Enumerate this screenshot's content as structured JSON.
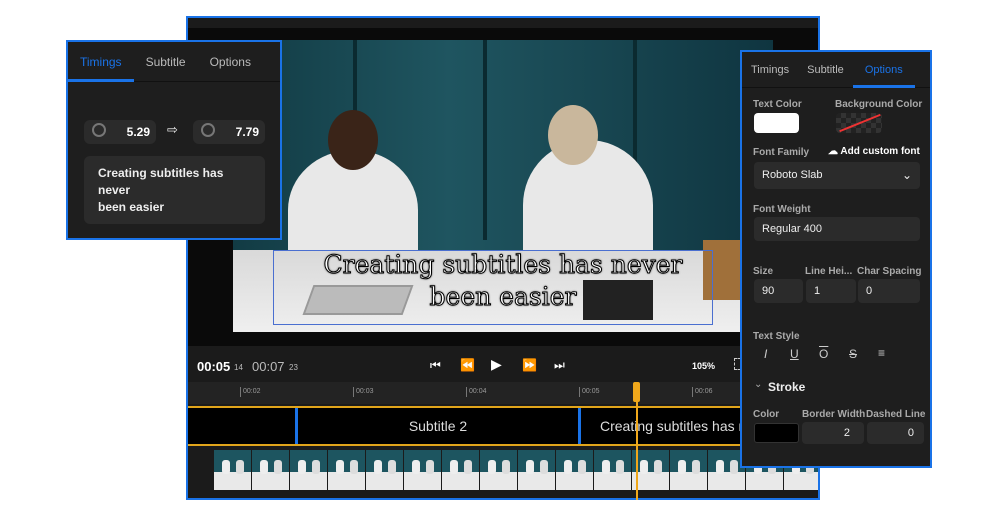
{
  "colors": {
    "accent": "#1a73e8",
    "playhead": "#f0a81b",
    "track_border": "#e1a51b"
  },
  "video": {
    "subtitle_line1": "Creating subtitles has never",
    "subtitle_line2": "been easier"
  },
  "player": {
    "current_time": "00:05",
    "current_frame": "14",
    "total_time": "00:07",
    "total_frame": "23",
    "zoom": "105%",
    "icons": [
      "skip-start-icon",
      "rewind-icon",
      "play-icon",
      "fast-forward-icon",
      "skip-end-icon",
      "fullscreen-icon"
    ]
  },
  "timeline": {
    "ticks": [
      "00:02",
      "00:03",
      "00:04",
      "00:05",
      "00:06"
    ],
    "segments": [
      "",
      "Subtitle 2",
      "Creating subtitles has never been easier"
    ]
  },
  "timings_panel": {
    "tabs": [
      "Timings",
      "Subtitle",
      "Options"
    ],
    "active_tab": "Timings",
    "start": "5.29",
    "end": "7.79",
    "text_line1": "Creating subtitles has",
    "text_line2": "never",
    "text_line3": "been easier"
  },
  "options_panel": {
    "tabs": [
      "Timings",
      "Subtitle",
      "Options"
    ],
    "active_tab": "Options",
    "text_color_label": "Text Color",
    "text_color": "#ffffff",
    "bg_color_label": "Background Color",
    "font_family_label": "Font Family",
    "add_font": "Add custom font",
    "font_family": "Roboto Slab",
    "font_weight_label": "Font Weight",
    "font_weight": "Regular 400",
    "size_label": "Size",
    "size": "90",
    "line_height_label": "Line Hei...",
    "line_height": "1",
    "char_spacing_label": "Char Spacing",
    "char_spacing": "0",
    "text_style_label": "Text Style",
    "styles": [
      "I",
      "U",
      "O",
      "S",
      "≡"
    ],
    "stroke_label": "Stroke",
    "stroke_color_label": "Color",
    "stroke_color": "#000000",
    "border_width_label": "Border Width",
    "border_width": "2",
    "dashed_line_label": "Dashed Line",
    "dashed_line": "0"
  }
}
